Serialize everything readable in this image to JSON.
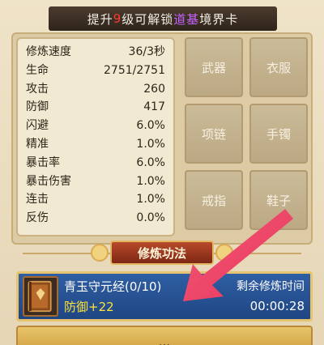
{
  "banner": {
    "prefix": "提升",
    "level": "9",
    "middle": "级可解锁",
    "realm": "道基",
    "suffix": "境界卡"
  },
  "stats": [
    {
      "label": "修炼速度",
      "value": "36/3秒"
    },
    {
      "label": "生命",
      "value": "2751/2751"
    },
    {
      "label": "攻击",
      "value": "260"
    },
    {
      "label": "防御",
      "value": "417"
    },
    {
      "label": "闪避",
      "value": "6.0%"
    },
    {
      "label": "精准",
      "value": "1.0%"
    },
    {
      "label": "暴击率",
      "value": "6.0%"
    },
    {
      "label": "暴击伤害",
      "value": "1.0%"
    },
    {
      "label": "连击",
      "value": "1.0%"
    },
    {
      "label": "反伤",
      "value": "0.0%"
    }
  ],
  "equipment": {
    "weapon": "武器",
    "clothes": "衣服",
    "necklace": "项链",
    "bracelet": "手镯",
    "ring": "戒指",
    "shoes": "鞋子"
  },
  "section": {
    "title": "修炼功法"
  },
  "technique": {
    "name": "青玉守元经(0/10)",
    "effect": "防御+22",
    "remain_label": "剩余修炼时间",
    "remain_time": "00:00:28"
  },
  "bottom_button": {
    "label": "..."
  },
  "colors": {
    "banner_bg": "#2f241b",
    "level_red": "#ff3b2f",
    "realm_purple": "#c463ff",
    "card_blue": "#2f5ea3",
    "effect_yellow": "#ffe23c",
    "arrow_pink": "#f0506e"
  }
}
